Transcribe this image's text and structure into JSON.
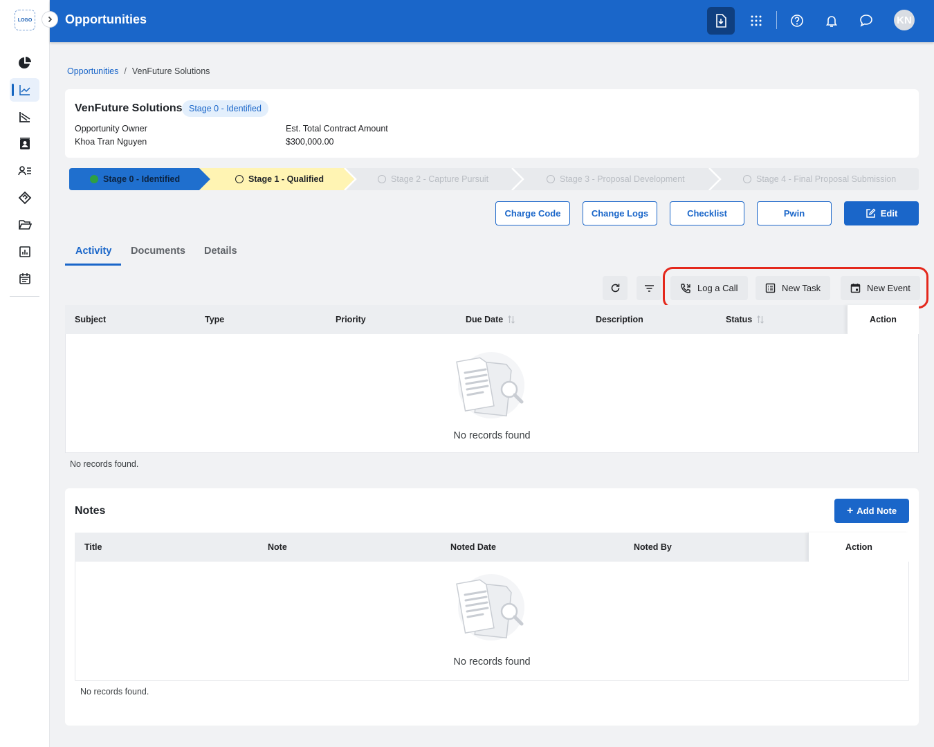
{
  "app": {
    "logo_text": "LOGO",
    "page_title": "Opportunities",
    "avatar_initials": "KN"
  },
  "breadcrumb": {
    "root": "Opportunities",
    "separator": "/",
    "current": "VenFuture Solutions"
  },
  "summary": {
    "name": "VenFuture Solutions",
    "stage_badge": "Stage 0 - Identified",
    "owner_label": "Opportunity Owner",
    "owner_value": "Khoa Tran Nguyen",
    "amount_label": "Est. Total Contract Amount",
    "amount_value": "$300,000.00"
  },
  "stages": [
    {
      "label": "Stage 0 - Identified",
      "state": "current",
      "color": "#1f6fce"
    },
    {
      "label": "Stage 1 - Qualified",
      "state": "next",
      "color": "#fff4b3"
    },
    {
      "label": "Stage 2 - Capture Pursuit",
      "state": "upcoming",
      "color": "#e8eaed"
    },
    {
      "label": "Stage 3 - Proposal Development",
      "state": "upcoming",
      "color": "#e8eaed"
    },
    {
      "label": "Stage 4 - Final Proposal Submission",
      "state": "upcoming",
      "color": "#e8eaed"
    }
  ],
  "actions": {
    "charge_code": "Charge Code",
    "change_logs": "Change Logs",
    "checklist": "Checklist",
    "pwin": "Pwin",
    "edit": "Edit"
  },
  "tabs": [
    {
      "label": "Activity",
      "active": true
    },
    {
      "label": "Documents",
      "active": false
    },
    {
      "label": "Details",
      "active": false
    }
  ],
  "activity_toolbar": {
    "log_call": "Log a Call",
    "new_task": "New Task",
    "new_event": "New Event"
  },
  "activity_table": {
    "columns": [
      "Subject",
      "Type",
      "Priority",
      "Due Date",
      "Description",
      "Status"
    ],
    "action_column": "Action",
    "empty_text": "No records found",
    "footnote": "No records found."
  },
  "notes": {
    "title": "Notes",
    "add_label": "Add Note",
    "columns": [
      "Title",
      "Note",
      "Noted Date",
      "Noted By"
    ],
    "action_column": "Action",
    "empty_text": "No records found",
    "footnote": "No records found."
  },
  "colors": {
    "primary": "#1a66c9",
    "highlight": "#e4281c",
    "success": "#2ea043"
  }
}
